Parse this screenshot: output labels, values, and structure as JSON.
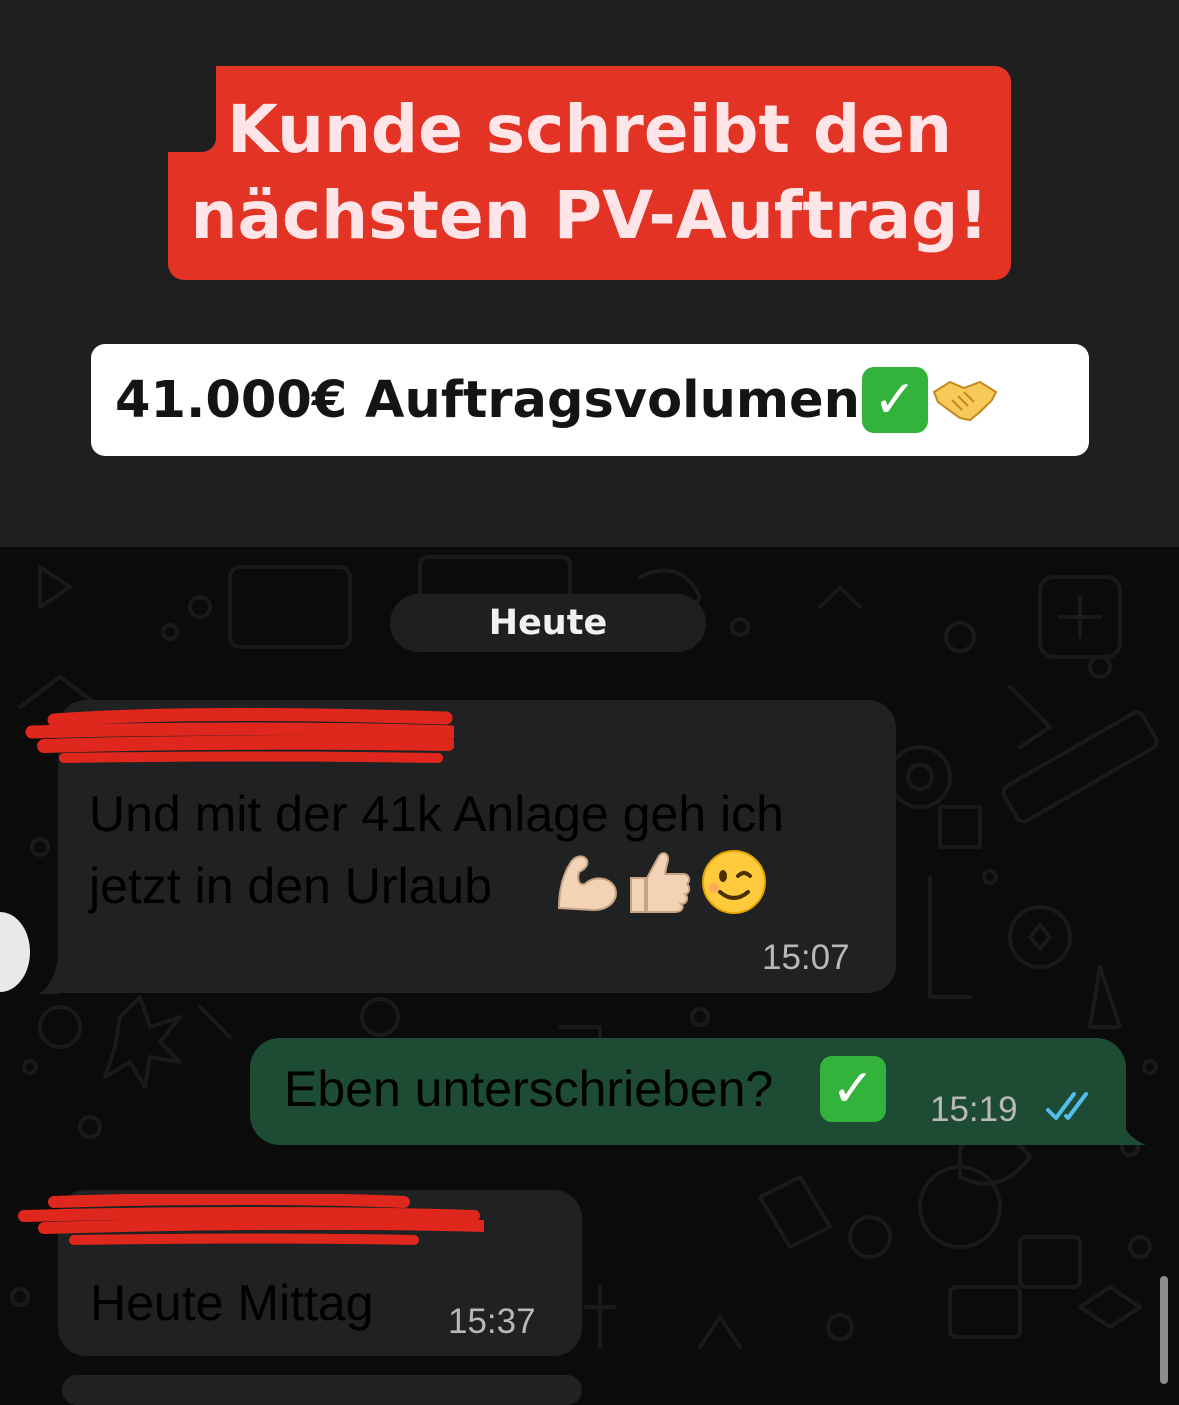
{
  "headline": {
    "line1": "Kunde schreibt den",
    "line2": "nächsten PV-Auftrag!"
  },
  "volume": {
    "text": "41.000€ Auftragsvolumen",
    "check_icon": "check-mark-button-icon",
    "handshake_icon": "handshake-icon"
  },
  "chat": {
    "date_label": "Heute",
    "messages": [
      {
        "direction": "incoming",
        "line1": "Und mit der 41k Anlage geh ich",
        "line2": "jetzt in den Urlaub",
        "emojis": [
          "flexed-biceps-icon",
          "thumbs-up-icon",
          "winking-face-icon"
        ],
        "time": "15:07"
      },
      {
        "direction": "outgoing",
        "text": "Eben unterschrieben?",
        "emoji": "check-mark-button-icon",
        "time": "15:19",
        "status_icon": "double-check-read-icon"
      },
      {
        "direction": "incoming",
        "text": "Heute Mittag",
        "time": "15:37"
      }
    ]
  },
  "colors": {
    "headline_bg": "#e23324",
    "incoming_bubble": "#202122",
    "outgoing_bubble": "#1d4b34",
    "read_check": "#53bdeb",
    "redaction": "#e0271d"
  }
}
